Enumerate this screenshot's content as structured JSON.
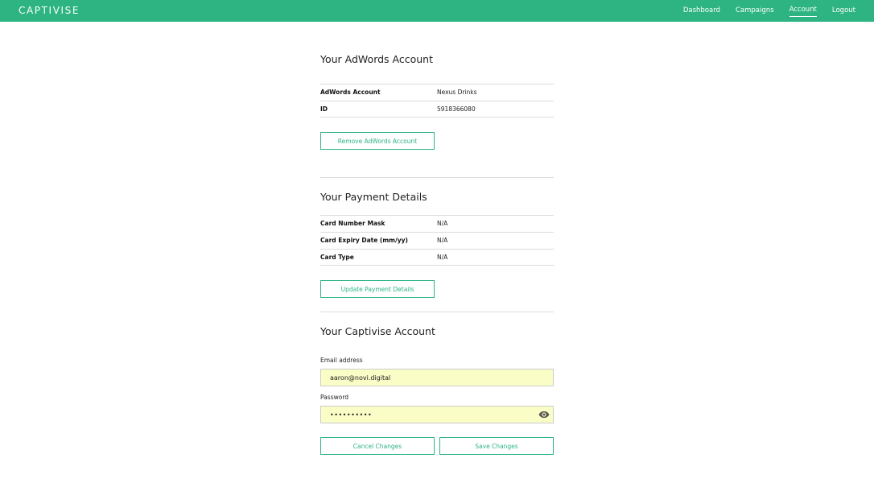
{
  "header": {
    "logo": "CAPTIVISE",
    "nav": [
      "Dashboard",
      "Campaigns",
      "Account",
      "Logout"
    ],
    "active_nav": "Account"
  },
  "adwords": {
    "title": "Your AdWords Account",
    "rows": [
      {
        "label": "AdWords Account",
        "value": "Nexus Drinks"
      },
      {
        "label": "ID",
        "value": "5918366080"
      }
    ],
    "button": "Remove AdWords Account"
  },
  "payment": {
    "title": "Your Payment Details",
    "rows": [
      {
        "label": "Card Number Mask",
        "value": "N/A"
      },
      {
        "label": "Card Expiry Date (mm/yy)",
        "value": "N/A"
      },
      {
        "label": "Card Type",
        "value": "N/A"
      }
    ],
    "button": "Update Payment Details"
  },
  "account": {
    "title": "Your Captivise Account",
    "email_label": "Email address",
    "email_value": "aaron@novi.digital",
    "password_label": "Password",
    "password_value": "••••••••••",
    "cancel_button": "Cancel Changes",
    "save_button": "Save Changes"
  },
  "colors": {
    "brand": "#2db482",
    "autofill": "#fafdc6"
  },
  "icons": [
    "eye-icon"
  ]
}
